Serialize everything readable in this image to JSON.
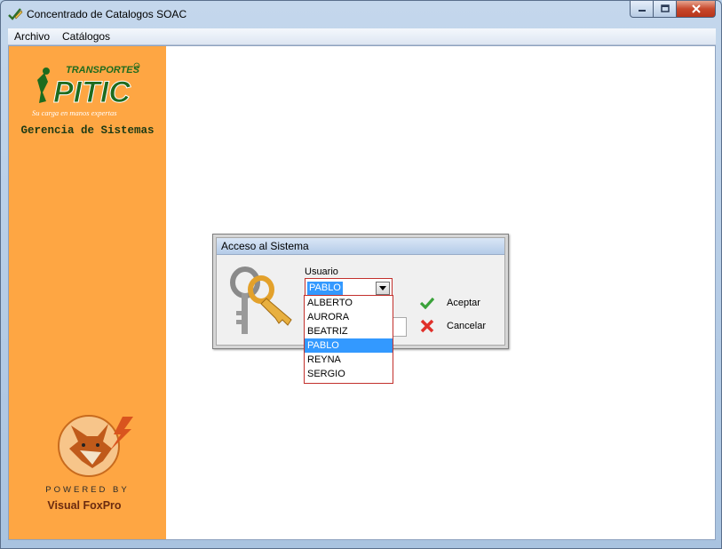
{
  "window": {
    "title": "Concentrado de Catalogos SOAC"
  },
  "menu": {
    "items": [
      "Archivo",
      "Catálogos"
    ]
  },
  "sidebar": {
    "logo_text": "TRANSPORTES PITIC",
    "logo_slogan": "Su carga en manos expertas",
    "department": "Gerencia de Sistemas",
    "powered_by": "POWERED BY",
    "product": "Visual FoxPro"
  },
  "login_dialog": {
    "title": "Acceso al Sistema",
    "user_label": "Usuario",
    "user_value": "PABLO",
    "user_options": [
      "ALBERTO",
      "AURORA",
      "BEATRIZ",
      "PABLO",
      "REYNA",
      "SERGIO"
    ],
    "selected_index": 3,
    "accept_label": "Aceptar",
    "cancel_label": "Cancelar"
  },
  "colors": {
    "sidebar": "#fea643",
    "selection": "#3399ff",
    "focus_border": "#c2302c"
  }
}
